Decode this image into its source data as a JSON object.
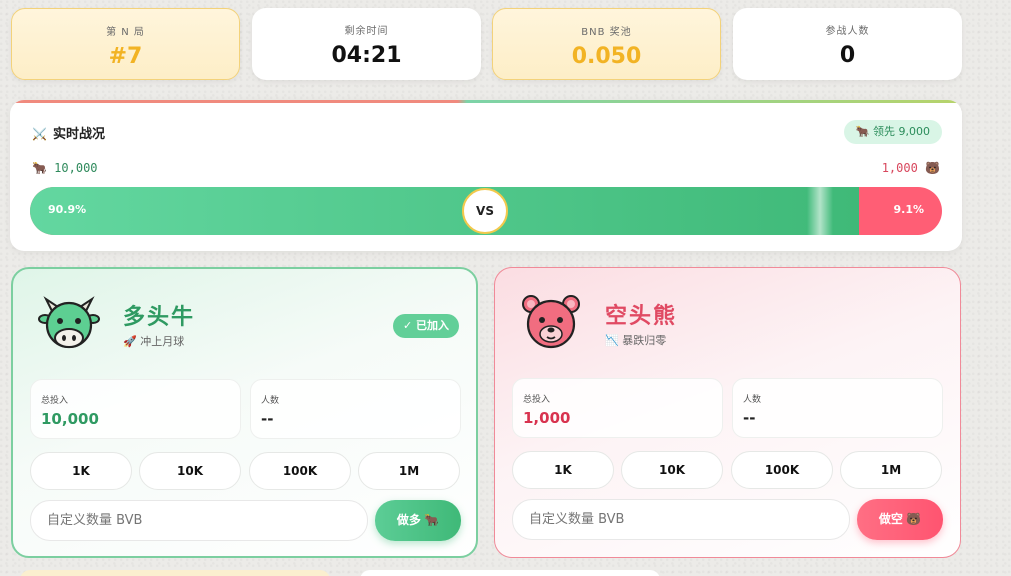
{
  "stats": [
    {
      "label": "第 N 局",
      "value": "#7"
    },
    {
      "label": "剩余时间",
      "value": "04:21"
    },
    {
      "label": "BNB 奖池",
      "value": "0.050"
    },
    {
      "label": "参战人数",
      "value": "0"
    }
  ],
  "battle": {
    "title": "实时战况",
    "title_icon": "⚔️",
    "lead": "🐂 领先 9,000",
    "bull_total": "🐂 10,000",
    "bear_total": "1,000 🐻",
    "bull_pct": "90.9%",
    "bear_pct": "9.1%",
    "bull_share": 0.909,
    "vs": "VS"
  },
  "bull": {
    "title": "多头牛",
    "subtitle": "🚀 冲上月球",
    "joined": "✓ 已加入",
    "total_label": "总投入",
    "total_value": "10,000",
    "count_label": "人数",
    "count_value": "--",
    "amounts": [
      "1K",
      "10K",
      "100K",
      "1M"
    ],
    "input_placeholder": "自定义数量 BVB",
    "action": "做多 🐂"
  },
  "bear": {
    "title": "空头熊",
    "subtitle": "📉 暴跌归零",
    "total_label": "总投入",
    "total_value": "1,000",
    "count_label": "人数",
    "count_value": "--",
    "amounts": [
      "1K",
      "10K",
      "100K",
      "1M"
    ],
    "input_placeholder": "自定义数量 BVB",
    "action": "做空 🐻"
  },
  "colors": {
    "bull": "#3fb978",
    "bear": "#ff5470",
    "gold": "#f2b324"
  }
}
